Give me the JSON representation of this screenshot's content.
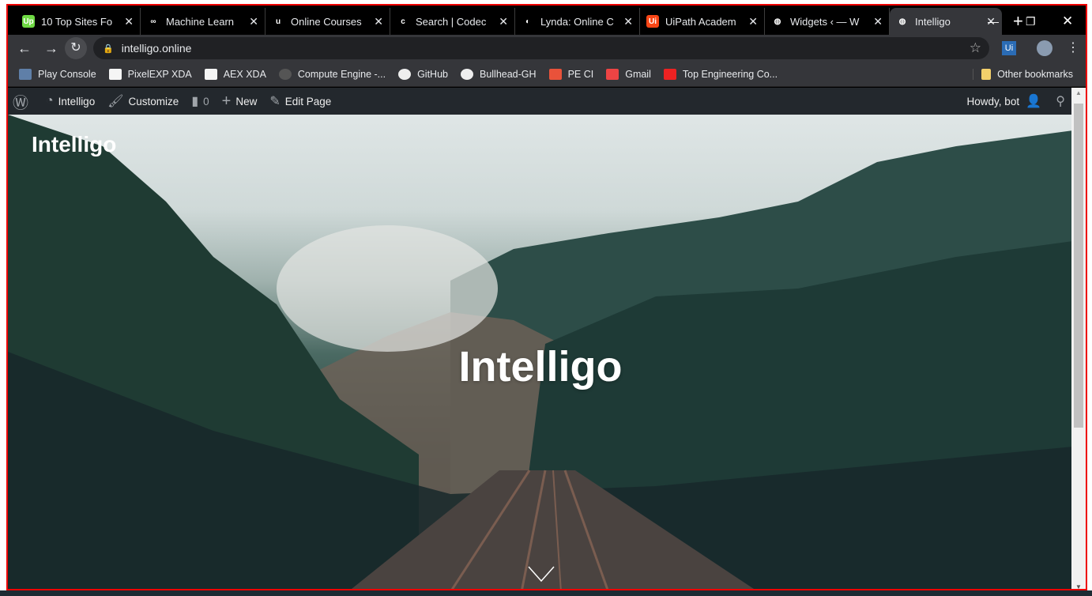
{
  "tabs": [
    {
      "title": "10 Top Sites Fo",
      "icon": "upwork-icon",
      "color": "#6fda44",
      "glyph": "Up"
    },
    {
      "title": "Machine Learn",
      "icon": "coursera-icon",
      "color": "#000",
      "glyph": "∞"
    },
    {
      "title": "Online Courses",
      "icon": "udemy-icon",
      "color": "#000",
      "glyph": "u"
    },
    {
      "title": "Search | Codec",
      "icon": "codecademy-icon",
      "color": "#000",
      "glyph": "c"
    },
    {
      "title": "Lynda: Online C",
      "icon": "lynda-icon",
      "color": "#000",
      "glyph": "◐"
    },
    {
      "title": "UiPath Academ",
      "icon": "uipath-icon",
      "color": "#fa4616",
      "glyph": "Ui"
    },
    {
      "title": "Widgets ‹ — W",
      "icon": "globe-icon",
      "color": "#000",
      "glyph": "◍"
    },
    {
      "title": "Intelligo",
      "icon": "globe-icon",
      "color": "#35363a",
      "glyph": "◍"
    }
  ],
  "url": "intelligo.online",
  "bookmarks": [
    "Play Console",
    "PixelEXP XDA",
    "AEX XDA",
    "Compute Engine -...",
    "GitHub",
    "Bullhead-GH",
    "PE CI",
    "Gmail",
    "Top Engineering Co..."
  ],
  "other_bookmarks": "Other bookmarks",
  "extension": "Ui",
  "admin": {
    "site": "Intelligo",
    "customize": "Customize",
    "comments": "0",
    "new": "New",
    "edit": "Edit Page",
    "howdy": "Howdy, bot"
  },
  "site_title": "Intelligo",
  "hero_title": "Intelligo"
}
